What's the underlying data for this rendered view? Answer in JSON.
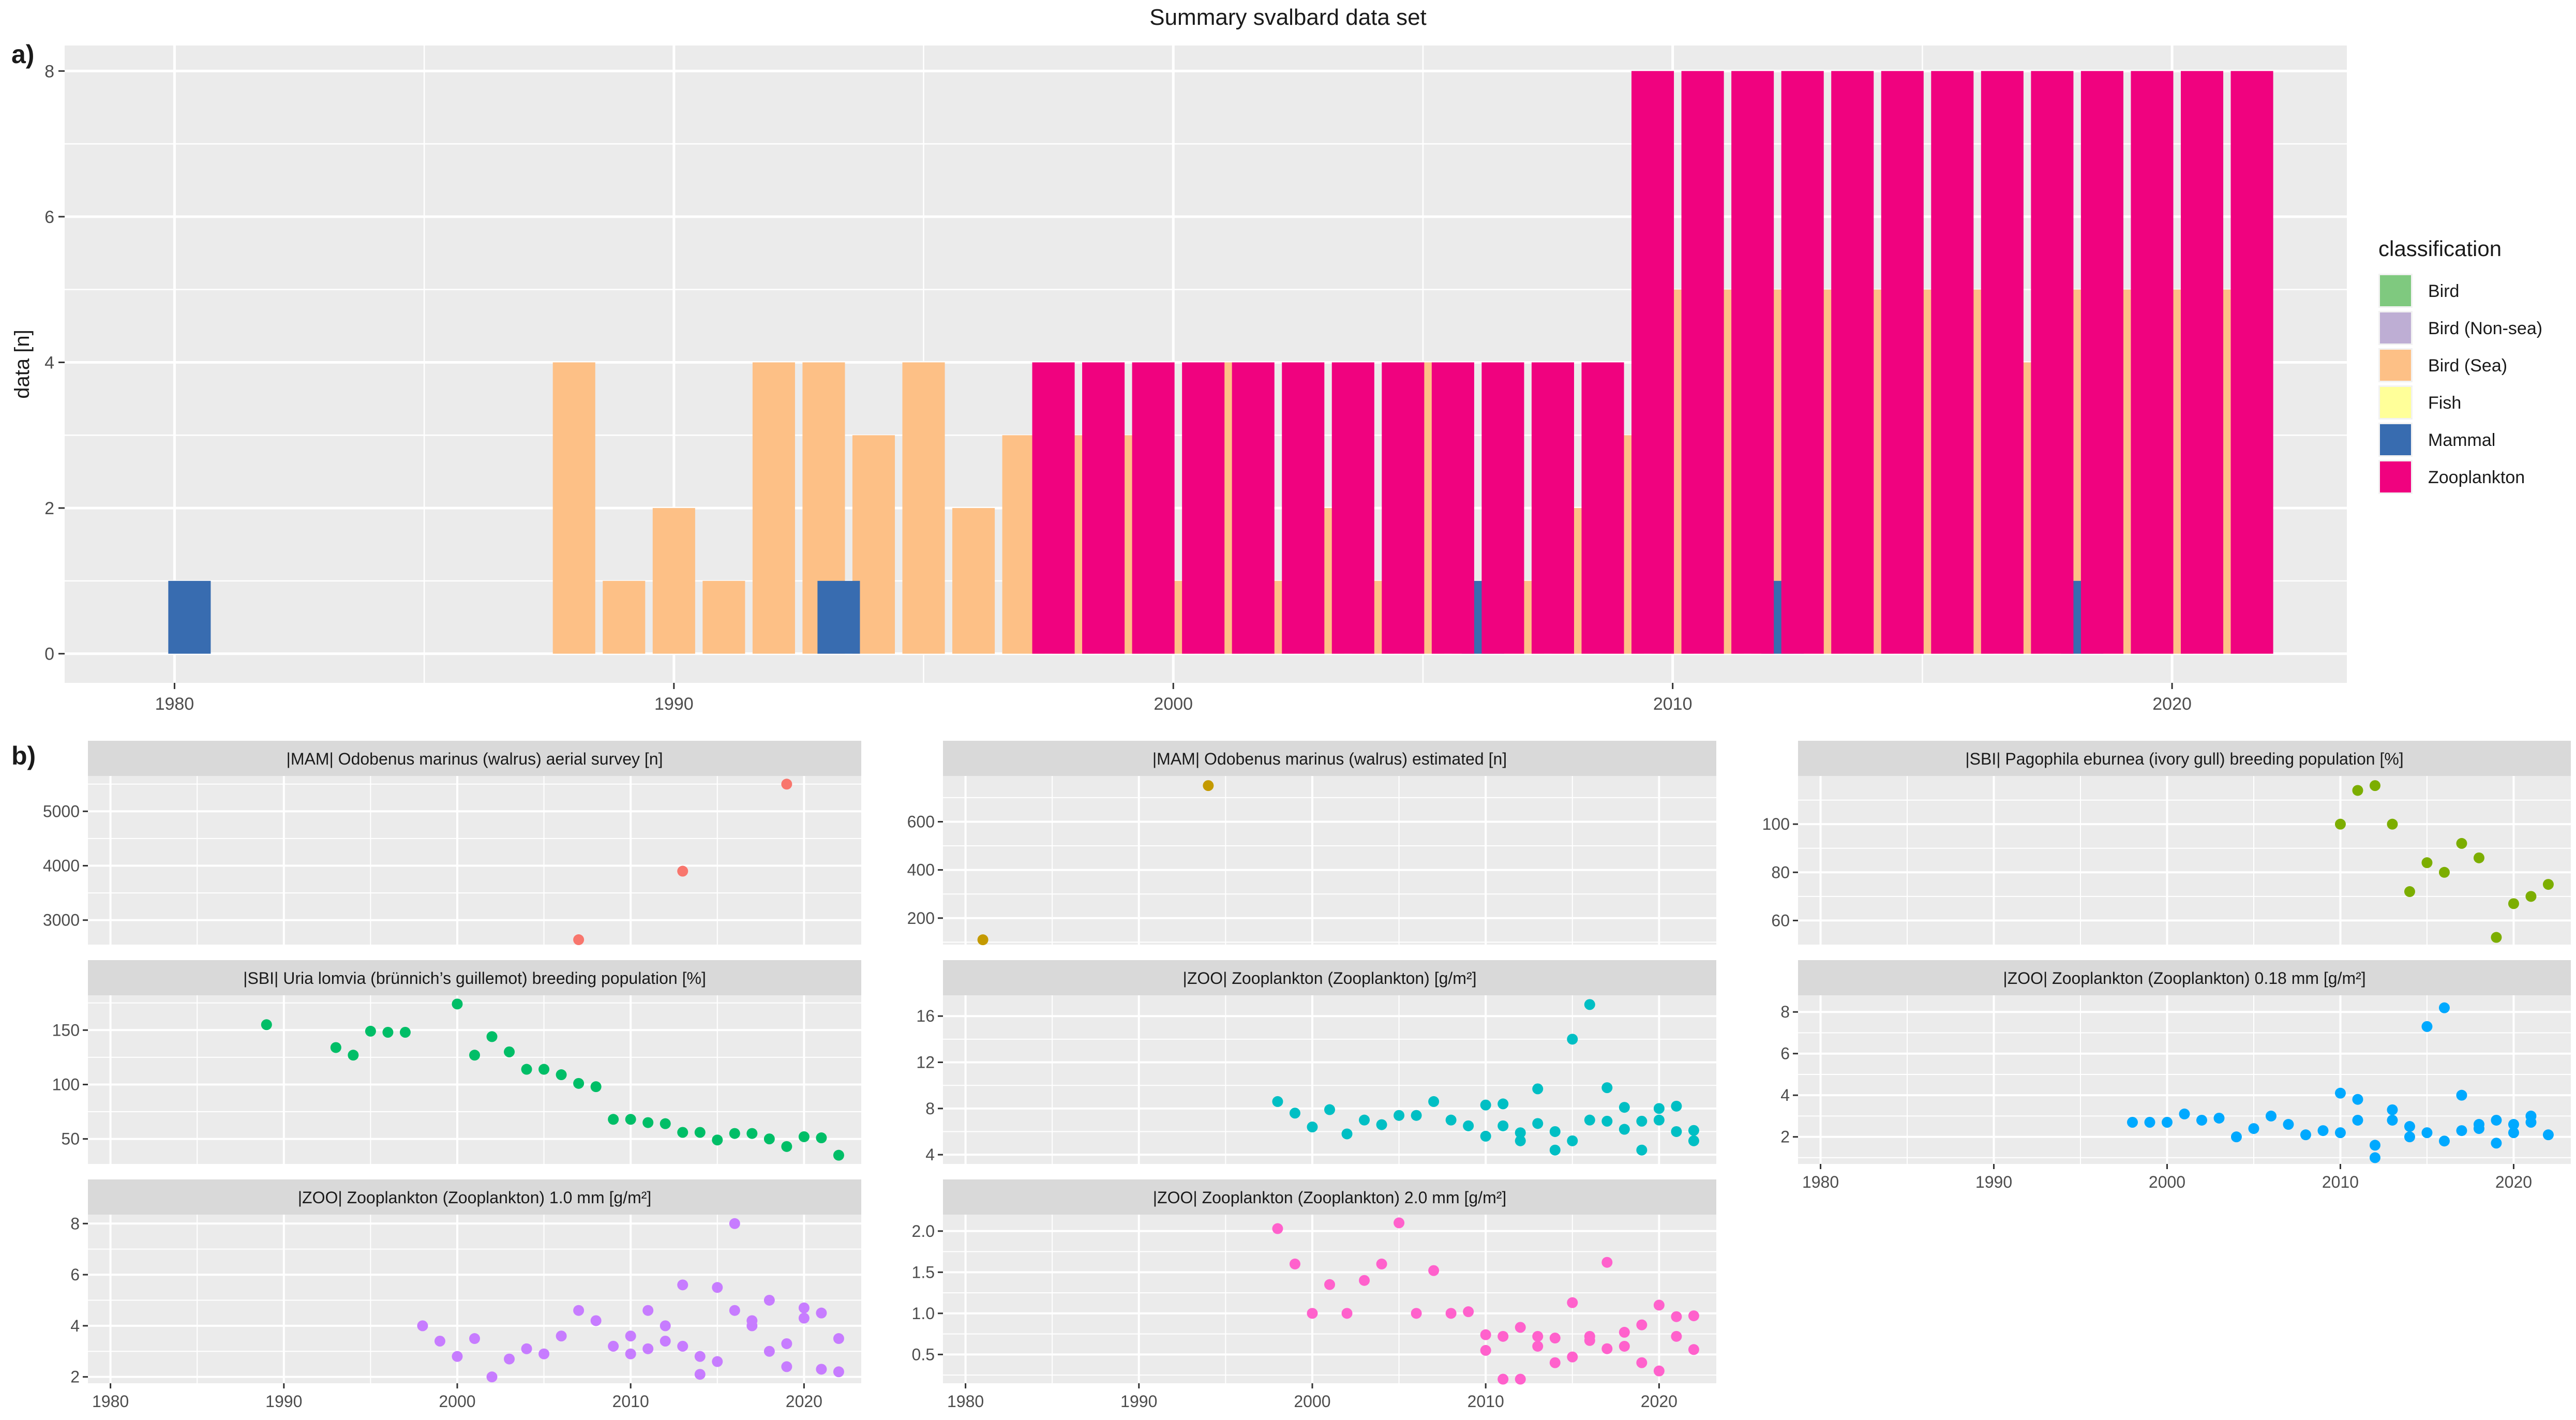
{
  "figure": {
    "title": "Summary svalbard data set",
    "panel_a_label": "a)",
    "panel_b_label": "b)"
  },
  "colors": {
    "Bird": "#7fc97f",
    "Bird (Non-sea)": "#beaed4",
    "Bird (Sea)": "#fdc086",
    "Fish": "#ffff99",
    "Mammal": "#386cb0",
    "Zooplankton": "#f0027f",
    "panel_bg": "#ebebeb",
    "strip_bg": "#d9d9d9",
    "grid": "#ffffff",
    "text_dark": "#1a1a1a",
    "text_axis": "#4d4d4d"
  },
  "chart_data": [
    {
      "id": "summary",
      "type": "bar",
      "title": "Summary svalbard data set",
      "xlabel": "",
      "ylabel": "data [n]",
      "xlim": [
        1977.8,
        2023.5
      ],
      "ylim": [
        -0.4,
        8.35
      ],
      "xticks": [
        1980,
        1990,
        2000,
        2010,
        2020
      ],
      "yticks": [
        0,
        2,
        4,
        6,
        8
      ],
      "bar_width": 0.85,
      "legend": {
        "title": "classification",
        "position": "right",
        "entries": [
          "Bird",
          "Bird (Non-sea)",
          "Bird (Sea)",
          "Fish",
          "Mammal",
          "Zooplankton"
        ]
      },
      "series": [
        {
          "name": "Bird (Sea)",
          "points": [
            [
              1988,
              4
            ],
            [
              1989,
              1
            ],
            [
              1990,
              2
            ],
            [
              1991,
              1
            ],
            [
              1992,
              4
            ],
            [
              1993,
              4
            ],
            [
              1994,
              3
            ],
            [
              1995,
              4
            ],
            [
              1996,
              2
            ],
            [
              1997,
              3
            ],
            [
              1998,
              3
            ],
            [
              1999,
              3
            ],
            [
              2000,
              1
            ],
            [
              2001,
              4
            ],
            [
              2002,
              1
            ],
            [
              2003,
              2
            ],
            [
              2004,
              1
            ],
            [
              2005,
              4
            ],
            [
              2006,
              1
            ],
            [
              2007,
              1
            ],
            [
              2008,
              2
            ],
            [
              2009,
              3
            ],
            [
              2010,
              5
            ],
            [
              2011,
              5
            ],
            [
              2012,
              5
            ],
            [
              2013,
              5
            ],
            [
              2014,
              5
            ],
            [
              2015,
              5
            ],
            [
              2016,
              5
            ],
            [
              2017,
              4
            ],
            [
              2018,
              5
            ],
            [
              2019,
              5
            ],
            [
              2020,
              5
            ],
            [
              2021,
              5
            ]
          ]
        },
        {
          "name": "Mammal",
          "points": [
            [
              1980.3,
              1
            ],
            [
              1993.3,
              1
            ],
            [
              2006.2,
              1
            ],
            [
              2012.2,
              1
            ],
            [
              2018.2,
              1
            ]
          ]
        },
        {
          "name": "Zooplankton",
          "points": [
            [
              1997.6,
              4
            ],
            [
              1998.6,
              4
            ],
            [
              1999.6,
              4
            ],
            [
              2000.6,
              4
            ],
            [
              2001.6,
              4
            ],
            [
              2002.6,
              4
            ],
            [
              2003.6,
              4
            ],
            [
              2004.6,
              4
            ],
            [
              2005.6,
              4
            ],
            [
              2006.6,
              4
            ],
            [
              2007.6,
              4
            ],
            [
              2008.6,
              4
            ],
            [
              2009.6,
              8
            ],
            [
              2010.6,
              8
            ],
            [
              2011.6,
              8
            ],
            [
              2012.6,
              8
            ],
            [
              2013.6,
              8
            ],
            [
              2014.6,
              8
            ],
            [
              2015.6,
              8
            ],
            [
              2016.6,
              8
            ],
            [
              2017.6,
              8
            ],
            [
              2018.6,
              8
            ],
            [
              2019.6,
              8
            ],
            [
              2020.6,
              8
            ],
            [
              2021.6,
              8
            ]
          ]
        }
      ]
    },
    {
      "id": "walrus_aerial",
      "type": "scatter",
      "title": "|MAM| Odobenus marinus (walrus) aerial survey [n]",
      "color": "#f8766d",
      "xlim": [
        1978.7,
        2023.3
      ],
      "ylim": [
        2550,
        5650
      ],
      "yticks": [
        3000,
        4000,
        5000
      ],
      "points": [
        [
          2007,
          2640
        ],
        [
          2013,
          3900
        ],
        [
          2019,
          5500
        ]
      ]
    },
    {
      "id": "walrus_estimated",
      "type": "scatter",
      "title": "|MAM| Odobenus marinus (walrus) estimated [n]",
      "color": "#c49a00",
      "xlim": [
        1978.7,
        2023.3
      ],
      "ylim": [
        90,
        790
      ],
      "yticks": [
        200,
        400,
        600
      ],
      "points": [
        [
          1981,
          110
        ],
        [
          1994,
          750
        ]
      ]
    },
    {
      "id": "ivory_gull",
      "type": "scatter",
      "title": "|SBI| Pagophila eburnea (ivory gull) breeding population [%]",
      "color": "#7cae00",
      "xlim": [
        1978.7,
        2023.3
      ],
      "ylim": [
        50,
        120
      ],
      "yticks": [
        60,
        80,
        100
      ],
      "points": [
        [
          2010,
          100
        ],
        [
          2011,
          114
        ],
        [
          2012,
          116
        ],
        [
          2013,
          100
        ],
        [
          2014,
          72
        ],
        [
          2015,
          84
        ],
        [
          2016,
          80
        ],
        [
          2017,
          92
        ],
        [
          2018,
          86
        ],
        [
          2019,
          53
        ],
        [
          2020,
          67
        ],
        [
          2021,
          70
        ],
        [
          2022,
          75
        ]
      ]
    },
    {
      "id": "uria_lomvia",
      "type": "scatter",
      "title": "|SBI| Uria lomvia (brünnich’s guillemot) breeding population [%]",
      "color": "#00be67",
      "xlim": [
        1978.7,
        2023.3
      ],
      "ylim": [
        27,
        182
      ],
      "yticks": [
        50,
        100,
        150
      ],
      "points": [
        [
          1989,
          155
        ],
        [
          1993,
          134
        ],
        [
          1994,
          127
        ],
        [
          1995,
          149
        ],
        [
          1996,
          148
        ],
        [
          1997,
          148
        ],
        [
          2000,
          174
        ],
        [
          2001,
          127
        ],
        [
          2002,
          144
        ],
        [
          2003,
          130
        ],
        [
          2004,
          114
        ],
        [
          2005,
          114
        ],
        [
          2006,
          109
        ],
        [
          2007,
          101
        ],
        [
          2008,
          98
        ],
        [
          2009,
          68
        ],
        [
          2010,
          68
        ],
        [
          2011,
          65
        ],
        [
          2012,
          64
        ],
        [
          2013,
          56
        ],
        [
          2014,
          56
        ],
        [
          2015,
          49
        ],
        [
          2016,
          55
        ],
        [
          2017,
          55
        ],
        [
          2018,
          50
        ],
        [
          2019,
          43
        ],
        [
          2020,
          52
        ],
        [
          2021,
          51
        ],
        [
          2022,
          35
        ]
      ]
    },
    {
      "id": "zoo_total",
      "type": "scatter",
      "title": "|ZOO| Zooplankton (Zooplankton) [g/m²]",
      "color": "#00bfc4",
      "xlim": [
        1978.7,
        2023.3
      ],
      "ylim": [
        3.2,
        17.8
      ],
      "yticks": [
        4,
        8,
        12,
        16
      ],
      "points": [
        [
          1998,
          8.6
        ],
        [
          1999,
          7.6
        ],
        [
          2000,
          6.4
        ],
        [
          2001,
          7.9
        ],
        [
          2002,
          5.8
        ],
        [
          2003,
          7.0
        ],
        [
          2004,
          6.6
        ],
        [
          2005,
          7.4
        ],
        [
          2006,
          7.4
        ],
        [
          2007,
          8.6
        ],
        [
          2008,
          7.0
        ],
        [
          2009,
          6.5
        ],
        [
          2010,
          8.3
        ],
        [
          2010,
          5.6
        ],
        [
          2011,
          8.4
        ],
        [
          2011,
          6.5
        ],
        [
          2012,
          5.9
        ],
        [
          2012,
          5.2
        ],
        [
          2013,
          6.7
        ],
        [
          2013,
          9.7
        ],
        [
          2014,
          6.0
        ],
        [
          2014,
          4.4
        ],
        [
          2015,
          14.0
        ],
        [
          2015,
          5.2
        ],
        [
          2016,
          17.0
        ],
        [
          2016,
          7.0
        ],
        [
          2017,
          9.8
        ],
        [
          2017,
          6.9
        ],
        [
          2018,
          8.1
        ],
        [
          2018,
          6.2
        ],
        [
          2019,
          6.9
        ],
        [
          2019,
          4.4
        ],
        [
          2020,
          8.0
        ],
        [
          2020,
          7.0
        ],
        [
          2021,
          8.2
        ],
        [
          2021,
          6.0
        ],
        [
          2022,
          6.1
        ],
        [
          2022,
          5.2
        ]
      ]
    },
    {
      "id": "zoo_018",
      "type": "scatter",
      "title": "|ZOO| Zooplankton (Zooplankton) 0.18 mm [g/m²]",
      "color": "#00a9ff",
      "xlim": [
        1978.7,
        2023.3
      ],
      "ylim": [
        0.7,
        8.8
      ],
      "yticks": [
        2,
        4,
        6,
        8
      ],
      "points": [
        [
          1998,
          2.7
        ],
        [
          1999,
          2.7
        ],
        [
          2000,
          2.7
        ],
        [
          2001,
          3.1
        ],
        [
          2002,
          2.8
        ],
        [
          2003,
          2.9
        ],
        [
          2004,
          2.0
        ],
        [
          2005,
          2.4
        ],
        [
          2006,
          3.0
        ],
        [
          2007,
          2.6
        ],
        [
          2008,
          2.1
        ],
        [
          2009,
          2.3
        ],
        [
          2010,
          4.1
        ],
        [
          2010,
          2.2
        ],
        [
          2011,
          3.8
        ],
        [
          2011,
          2.8
        ],
        [
          2012,
          1.6
        ],
        [
          2012,
          1.0
        ],
        [
          2013,
          3.3
        ],
        [
          2013,
          2.8
        ],
        [
          2014,
          2.5
        ],
        [
          2014,
          2.0
        ],
        [
          2015,
          7.3
        ],
        [
          2015,
          2.2
        ],
        [
          2016,
          8.2
        ],
        [
          2016,
          1.8
        ],
        [
          2017,
          4.0
        ],
        [
          2017,
          2.3
        ],
        [
          2018,
          2.6
        ],
        [
          2018,
          2.4
        ],
        [
          2019,
          2.8
        ],
        [
          2019,
          1.7
        ],
        [
          2020,
          2.6
        ],
        [
          2020,
          2.2
        ],
        [
          2021,
          3.0
        ],
        [
          2021,
          2.7
        ],
        [
          2022,
          2.1
        ]
      ]
    },
    {
      "id": "zoo_10",
      "type": "scatter",
      "title": "|ZOO| Zooplankton (Zooplankton) 1.0 mm [g/m²]",
      "color": "#c77cff",
      "xlim": [
        1978.7,
        2023.3
      ],
      "ylim": [
        1.75,
        8.35
      ],
      "yticks": [
        2,
        4,
        6,
        8
      ],
      "points": [
        [
          1998,
          4.0
        ],
        [
          1999,
          3.4
        ],
        [
          2000,
          2.8
        ],
        [
          2001,
          3.5
        ],
        [
          2002,
          2.0
        ],
        [
          2003,
          2.7
        ],
        [
          2004,
          3.1
        ],
        [
          2005,
          2.9
        ],
        [
          2006,
          3.6
        ],
        [
          2007,
          4.6
        ],
        [
          2008,
          4.2
        ],
        [
          2009,
          3.2
        ],
        [
          2010,
          3.6
        ],
        [
          2010,
          2.9
        ],
        [
          2011,
          4.6
        ],
        [
          2011,
          3.1
        ],
        [
          2012,
          4.0
        ],
        [
          2012,
          3.4
        ],
        [
          2013,
          5.6
        ],
        [
          2013,
          3.2
        ],
        [
          2014,
          2.8
        ],
        [
          2014,
          2.1
        ],
        [
          2015,
          5.5
        ],
        [
          2015,
          2.6
        ],
        [
          2016,
          8.0
        ],
        [
          2016,
          4.6
        ],
        [
          2017,
          4.0
        ],
        [
          2017,
          4.2
        ],
        [
          2018,
          5.0
        ],
        [
          2018,
          3.0
        ],
        [
          2019,
          3.3
        ],
        [
          2019,
          2.4
        ],
        [
          2020,
          4.7
        ],
        [
          2020,
          4.3
        ],
        [
          2021,
          4.5
        ],
        [
          2021,
          2.3
        ],
        [
          2022,
          3.5
        ],
        [
          2022,
          2.2
        ]
      ]
    },
    {
      "id": "zoo_20",
      "type": "scatter",
      "title": "|ZOO| Zooplankton (Zooplankton) 2.0 mm [g/m²]",
      "color": "#ff61cc",
      "xlim": [
        1978.7,
        2023.3
      ],
      "ylim": [
        0.15,
        2.2
      ],
      "yticks": [
        0.5,
        1.0,
        1.5,
        2.0
      ],
      "ytick_labels": [
        "0.5",
        "1.0",
        "1.5",
        "2.0"
      ],
      "points": [
        [
          1998,
          2.03
        ],
        [
          1999,
          1.6
        ],
        [
          2000,
          1.0
        ],
        [
          2001,
          1.35
        ],
        [
          2002,
          1.0
        ],
        [
          2003,
          1.4
        ],
        [
          2004,
          1.6
        ],
        [
          2005,
          2.1
        ],
        [
          2006,
          1.0
        ],
        [
          2007,
          1.52
        ],
        [
          2008,
          1.0
        ],
        [
          2009,
          1.02
        ],
        [
          2010,
          0.74
        ],
        [
          2010,
          0.55
        ],
        [
          2011,
          0.72
        ],
        [
          2011,
          0.2
        ],
        [
          2012,
          0.83
        ],
        [
          2012,
          0.2
        ],
        [
          2013,
          0.72
        ],
        [
          2013,
          0.6
        ],
        [
          2014,
          0.7
        ],
        [
          2014,
          0.4
        ],
        [
          2015,
          1.13
        ],
        [
          2015,
          0.47
        ],
        [
          2016,
          0.72
        ],
        [
          2016,
          0.67
        ],
        [
          2017,
          1.62
        ],
        [
          2017,
          0.57
        ],
        [
          2018,
          0.77
        ],
        [
          2018,
          0.6
        ],
        [
          2019,
          0.86
        ],
        [
          2019,
          0.4
        ],
        [
          2020,
          1.1
        ],
        [
          2020,
          0.3
        ],
        [
          2021,
          0.96
        ],
        [
          2021,
          0.72
        ],
        [
          2022,
          0.97
        ],
        [
          2022,
          0.56
        ]
      ]
    }
  ],
  "facet_x_ticks": [
    1980,
    1990,
    2000,
    2010,
    2020
  ]
}
